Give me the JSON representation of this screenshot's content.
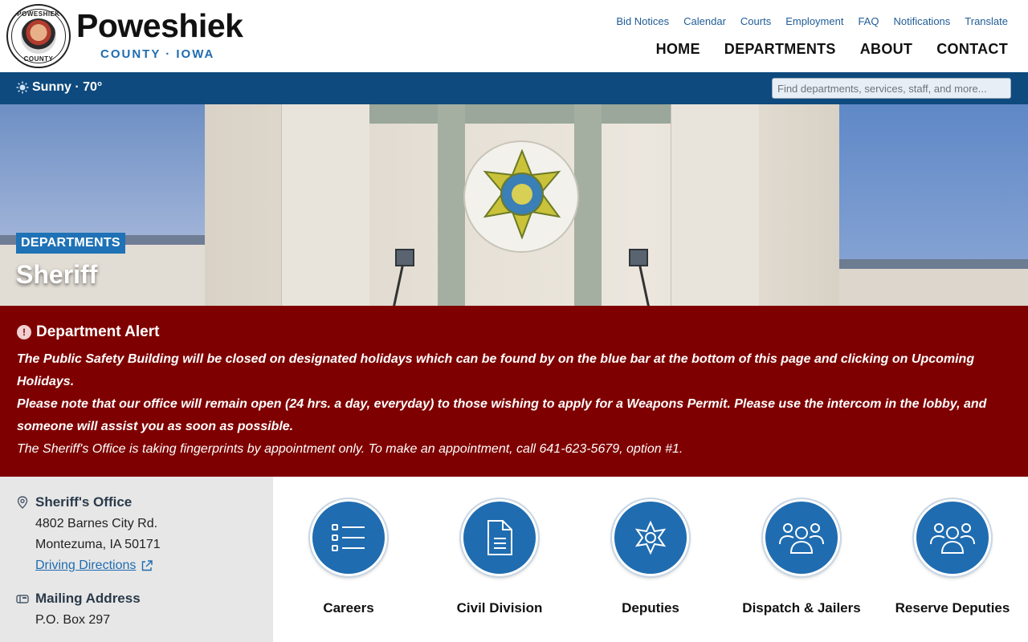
{
  "brand": {
    "seal_top": "POWESHIEK",
    "seal_bottom": "COUNTY",
    "name": "Poweshiek",
    "subtitle": "COUNTY · IOWA"
  },
  "utility_nav": [
    "Bid Notices",
    "Calendar",
    "Courts",
    "Employment",
    "FAQ",
    "Notifications",
    "Translate"
  ],
  "main_nav": [
    "HOME",
    "DEPARTMENTS",
    "ABOUT",
    "CONTACT"
  ],
  "weather": {
    "icon": "sun-icon",
    "text": "Sunny · 70°"
  },
  "search": {
    "placeholder": "Find departments, services, staff, and more..."
  },
  "hero": {
    "tag": "DEPARTMENTS",
    "title": "Sheriff"
  },
  "alert": {
    "title": "Department Alert",
    "lines": [
      "The Public Safety Building will be closed on designated holidays which can be found by on the blue bar at the bottom of this page and clicking on Upcoming Holidays.",
      "Please note that our office will remain open (24 hrs. a day, everyday) to those wishing to apply for a Weapons Permit.  Please use the intercom in the lobby, and someone will assist you as soon as possible.",
      "The Sheriff's Office is taking fingerprints by appointment only. To make an appointment, call 641-623-5679, option #1."
    ]
  },
  "office": {
    "title": "Sheriff's Office",
    "address1": "4802 Barnes City Rd.",
    "address2": "Montezuma, IA 50171",
    "directions": "Driving Directions"
  },
  "mailing": {
    "title": "Mailing Address",
    "line1": "P.O. Box 297"
  },
  "tiles": [
    {
      "label": "Careers",
      "icon": "list-icon"
    },
    {
      "label": "Civil Division",
      "icon": "document-icon"
    },
    {
      "label": "Deputies",
      "icon": "badge-icon"
    },
    {
      "label": "Dispatch & Jailers",
      "icon": "group-icon"
    },
    {
      "label": "Reserve Deputies",
      "icon": "group-icon"
    }
  ],
  "colors": {
    "primary": "#1f6cb0",
    "bar": "#0e4a7d",
    "alert": "#7f0000"
  }
}
